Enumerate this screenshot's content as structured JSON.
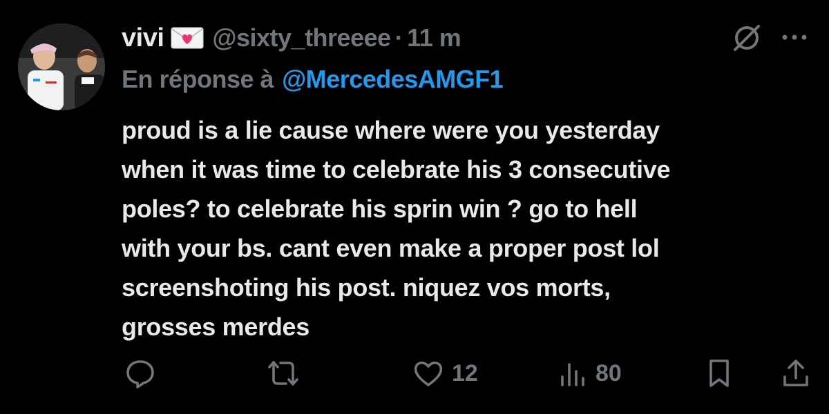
{
  "tweet": {
    "display_name": "vivi",
    "handle": "@sixty_threeee",
    "separator": "·",
    "time": "11 m",
    "reply_prefix": "En réponse à",
    "reply_target": "@MercedesAMGF1",
    "text": "proud is a lie cause where were you yesterday\nwhen it was time to celebrate his 3 consecutive\npoles? to celebrate his sprin win ? go to hell\nwith your bs. cant even make a proper post lol\nscreenshoting his post. niquez vos morts,\ngrosses merdes"
  },
  "actions": {
    "replies": "",
    "retweets": "",
    "likes": "12",
    "views": "80"
  },
  "icons": {
    "name_emoji": "love-letter-icon",
    "grok": "grok-icon",
    "more": "more-icon",
    "reply": "reply-icon",
    "retweet": "retweet-icon",
    "like": "heart-icon",
    "views": "views-icon",
    "bookmark": "bookmark-icon",
    "share": "share-icon"
  },
  "colors": {
    "background": "#000000",
    "text": "#e7e9ea",
    "muted": "#71767b",
    "link": "#1d9bf0",
    "heart_emoji": "#e8386b"
  }
}
